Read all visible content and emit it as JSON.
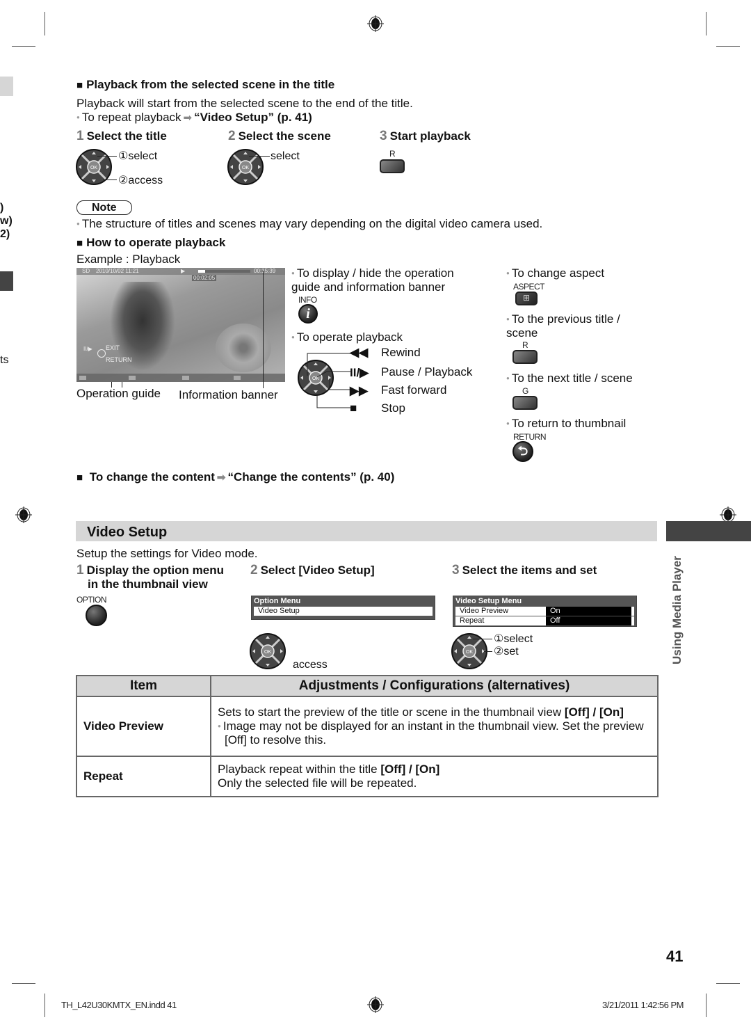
{
  "section_playback_scene": {
    "heading": "Playback from the selected scene in the title",
    "description": "Playback will start from the selected scene to the end of the title.",
    "repeat_note": "To repeat playback",
    "repeat_ref": "“Video Setup” (p. 41)",
    "steps": [
      {
        "num": "1",
        "label": "Select the title",
        "callouts": [
          "①select",
          "②access"
        ]
      },
      {
        "num": "2",
        "label": "Select the scene",
        "callouts": [
          "select"
        ]
      },
      {
        "num": "3",
        "label": "Start playback",
        "button_label": "R"
      }
    ]
  },
  "note": {
    "badge": "Note",
    "text": "The structure of titles and scenes may vary depending on the digital video camera used."
  },
  "section_operate": {
    "heading": "How to operate playback",
    "example": "Example : Playback",
    "video": {
      "quality": "SD",
      "date": "2010/10/02  11:21",
      "state_icon": "▶",
      "elapsed": "00:02:05",
      "total": "00:15:39",
      "progress_fraction": 0.13,
      "guide_exit": "EXIT",
      "guide_return": "RETURN",
      "guide_pause": "II/▶"
    },
    "callout_operation_guide": "Operation guide",
    "callout_information_banner": "Information banner",
    "info_text": "To display / hide the operation guide and information banner",
    "info_button_label": "INFO",
    "operate_text": "To operate playback",
    "controls": [
      {
        "symbol": "◀◀",
        "label": "Rewind"
      },
      {
        "symbol": "II/▶",
        "label": "Pause / Playback"
      },
      {
        "symbol": "▶▶",
        "label": "Fast forward"
      },
      {
        "symbol": "■",
        "label": "Stop"
      }
    ],
    "right_items": [
      {
        "text": "To change aspect",
        "button_label": "ASPECT"
      },
      {
        "text": "To the previous title / scene",
        "button_label": "R"
      },
      {
        "text": "To the next title / scene",
        "button_label": "G"
      },
      {
        "text": "To return to thumbnail",
        "button_label": "RETURN"
      }
    ]
  },
  "section_change_content": {
    "heading": "To change the content",
    "ref": "“Change the contents” (p. 40)"
  },
  "video_setup": {
    "title": "Video Setup",
    "intro": "Setup the settings for Video mode.",
    "steps": [
      {
        "num": "1",
        "label_line1": "Display the option menu",
        "label_line2": "in the thumbnail view",
        "button_label": "OPTION"
      },
      {
        "num": "2",
        "label": "Select [Video Setup]",
        "callout": "access"
      },
      {
        "num": "3",
        "label": "Select the items and set",
        "callouts": [
          "①select",
          "②set"
        ]
      }
    ],
    "option_menu": {
      "title": "Option Menu",
      "items": [
        "Video Setup"
      ]
    },
    "video_setup_menu": {
      "title": "Video Setup Menu",
      "rows": [
        {
          "label": "Video Preview",
          "value": "On"
        },
        {
          "label": "Repeat",
          "value": "Off"
        }
      ]
    }
  },
  "table": {
    "headers": [
      "Item",
      "Adjustments / Configurations (alternatives)"
    ],
    "rows": [
      {
        "item": "Video Preview",
        "line1": "Sets to start the preview of the title or scene in the thumbnail view ",
        "line1_options": "[Off] / [On]",
        "bullet": "Image may not be displayed for an instant in the thumbnail view. Set the preview [Off] to resolve this."
      },
      {
        "item": "Repeat",
        "line1": "Playback repeat within the title ",
        "line1_options": "[Off] / [On]",
        "line2": "Only the selected file will be repeated."
      }
    ]
  },
  "side_tab": {
    "label": "Using Media Player"
  },
  "left_margin_fragments": [
    ")",
    "w)",
    "2)",
    "ts"
  ],
  "page_number": "41",
  "footer": {
    "file": "TH_L42U30KMTX_EN.indd   41",
    "timestamp": "3/21/2011   1:42:56 PM"
  },
  "colors": {
    "section_band": "#d6d6d6",
    "side_tab": "#444444",
    "menu_bg": "#555555",
    "text": "#111111"
  }
}
